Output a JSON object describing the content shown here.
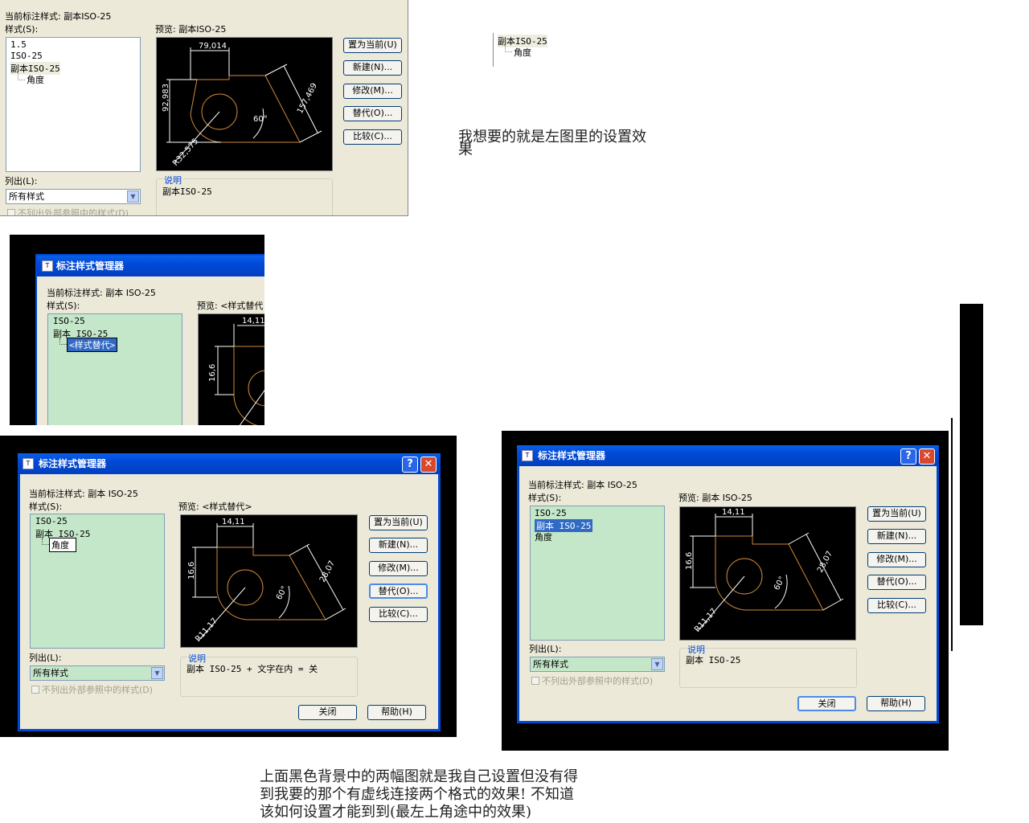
{
  "shot1": {
    "current_style": "当前标注样式: 副本ISO-25",
    "styles_label": "样式(S):",
    "preview_label": "预览: 副本ISO-25",
    "list": [
      "1.5",
      "ISO-25",
      "副本ISO-25",
      "角度"
    ],
    "buttons": [
      "置为当前(U)",
      "新建(N)...",
      "修改(M)...",
      "替代(O)...",
      "比较(C)..."
    ],
    "dims": {
      "top": "79,014",
      "left": "92,983",
      "right": "157,469",
      "angle": "60°",
      "radius": "R32,575"
    },
    "desc_title": "说明",
    "desc_text": "副本ISO-25",
    "list_label": "列出(L):",
    "list_value": "所有样式",
    "xref_label": "不列出外部参照中的样式(D)"
  },
  "tree_snippet": {
    "parent": "副本ISO-25",
    "child": "角度"
  },
  "note_top": [
    "我想要的就是左图里的设置效",
    "果"
  ],
  "shot2": {
    "title": "标注样式管理器",
    "current_style": "当前标注样式: 副本 ISO-25",
    "styles_label": "样式(S):",
    "preview_label": "预览: <样式替代",
    "list": [
      "ISO-25",
      "副本 ISO-25",
      "<样式替代>"
    ],
    "dims": {
      "top": "14,11",
      "left": "16,6"
    }
  },
  "shot3": {
    "title": "标注样式管理器",
    "current_style": "当前标注样式: 副本 ISO-25",
    "styles_label": "样式(S):",
    "preview_label": "预览: <样式替代>",
    "list": [
      "ISO-25",
      "副本 ISO-25",
      "角度"
    ],
    "buttons": [
      "置为当前(U)",
      "新建(N)...",
      "修改(M)...",
      "替代(O)...",
      "比较(C)..."
    ],
    "dims": {
      "top": "14,11",
      "left": "16,6",
      "right": "28,07",
      "angle": "60°",
      "radius": "R11,17"
    },
    "desc_title": "说明",
    "desc_text": "副本 ISO-25 + 文字在内 = 关",
    "list_label": "列出(L):",
    "list_value": "所有样式",
    "xref_label": "不列出外部参照中的样式(D)",
    "close_label": "关闭",
    "help_label": "帮助(H)"
  },
  "shot4": {
    "title": "标注样式管理器",
    "current_style": "当前标注样式: 副本 ISO-25",
    "styles_label": "样式(S):",
    "preview_label": "预览: 副本 ISO-25",
    "list": [
      "ISO-25",
      "副本 ISO-25",
      "角度"
    ],
    "buttons": [
      "置为当前(U)",
      "新建(N)...",
      "修改(M)...",
      "替代(O)...",
      "比较(C)..."
    ],
    "dims": {
      "top": "14,11",
      "left": "16,6",
      "right": "28,07",
      "angle": "60°",
      "radius": "R11,17"
    },
    "desc_title": "说明",
    "desc_text": "副本 ISO-25",
    "list_label": "列出(L):",
    "list_value": "所有样式",
    "xref_label": "不列出外部参照中的样式(D)",
    "close_label": "关闭",
    "help_label": "帮助(H)"
  },
  "note_bottom": [
    "上面黑色背景中的两幅图就是我自己设置但没有得",
    "到我要的那个有虚线连接两个格式的效果! 不知道",
    "该如何设置才能到到(最左上角途中的效果)"
  ],
  "colors": {
    "xp_title": "#0049d6",
    "dialog_bg": "#ece9d8",
    "list_green": "#c5e7c9",
    "preview_bg": "#000000",
    "cad_line": "#d08a3a"
  }
}
